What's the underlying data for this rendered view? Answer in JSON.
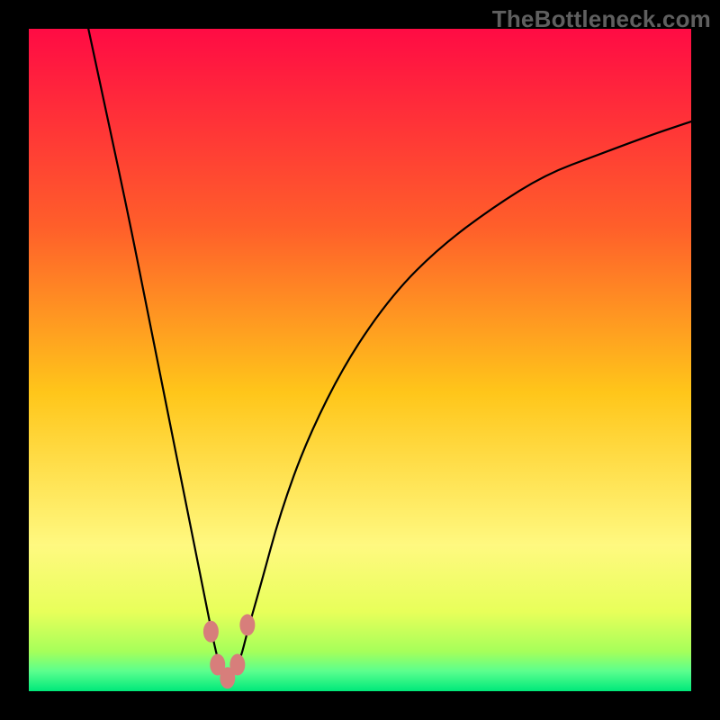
{
  "watermark": "TheBottleneck.com",
  "chart_data": {
    "type": "line",
    "title": "",
    "xlabel": "",
    "ylabel": "",
    "xlim": [
      0,
      100
    ],
    "ylim": [
      0,
      100
    ],
    "grid": false,
    "background_gradient": {
      "stops": [
        {
          "offset": 0.0,
          "color": "#ff0b44"
        },
        {
          "offset": 0.3,
          "color": "#ff5f2a"
        },
        {
          "offset": 0.55,
          "color": "#ffc61a"
        },
        {
          "offset": 0.78,
          "color": "#fff980"
        },
        {
          "offset": 0.88,
          "color": "#e8ff5a"
        },
        {
          "offset": 0.94,
          "color": "#a6ff5a"
        },
        {
          "offset": 0.97,
          "color": "#5aff8e"
        },
        {
          "offset": 1.0,
          "color": "#00e87a"
        }
      ]
    },
    "series": [
      {
        "name": "bottleneck-curve",
        "note": "V-shaped curve; y is mismatch/bottleneck level where 0=green bottom, 100=red top. Minimum near x≈30.",
        "x": [
          9,
          12,
          15,
          18,
          20,
          22,
          24,
          26,
          27,
          28,
          29,
          30,
          31,
          32,
          33,
          35,
          38,
          42,
          48,
          55,
          62,
          70,
          78,
          86,
          94,
          100
        ],
        "y": [
          100,
          86,
          72,
          57,
          47,
          37,
          27,
          17,
          12,
          7,
          3,
          2,
          3,
          5,
          9,
          16,
          27,
          38,
          50,
          60,
          67,
          73,
          78,
          81,
          84,
          86
        ]
      }
    ],
    "annotations": {
      "markers_near_minimum": [
        {
          "x": 27.5,
          "y": 9
        },
        {
          "x": 28.5,
          "y": 4
        },
        {
          "x": 30.0,
          "y": 2
        },
        {
          "x": 31.5,
          "y": 4
        },
        {
          "x": 33.0,
          "y": 10
        }
      ],
      "marker_color": "#d77e7b"
    }
  }
}
